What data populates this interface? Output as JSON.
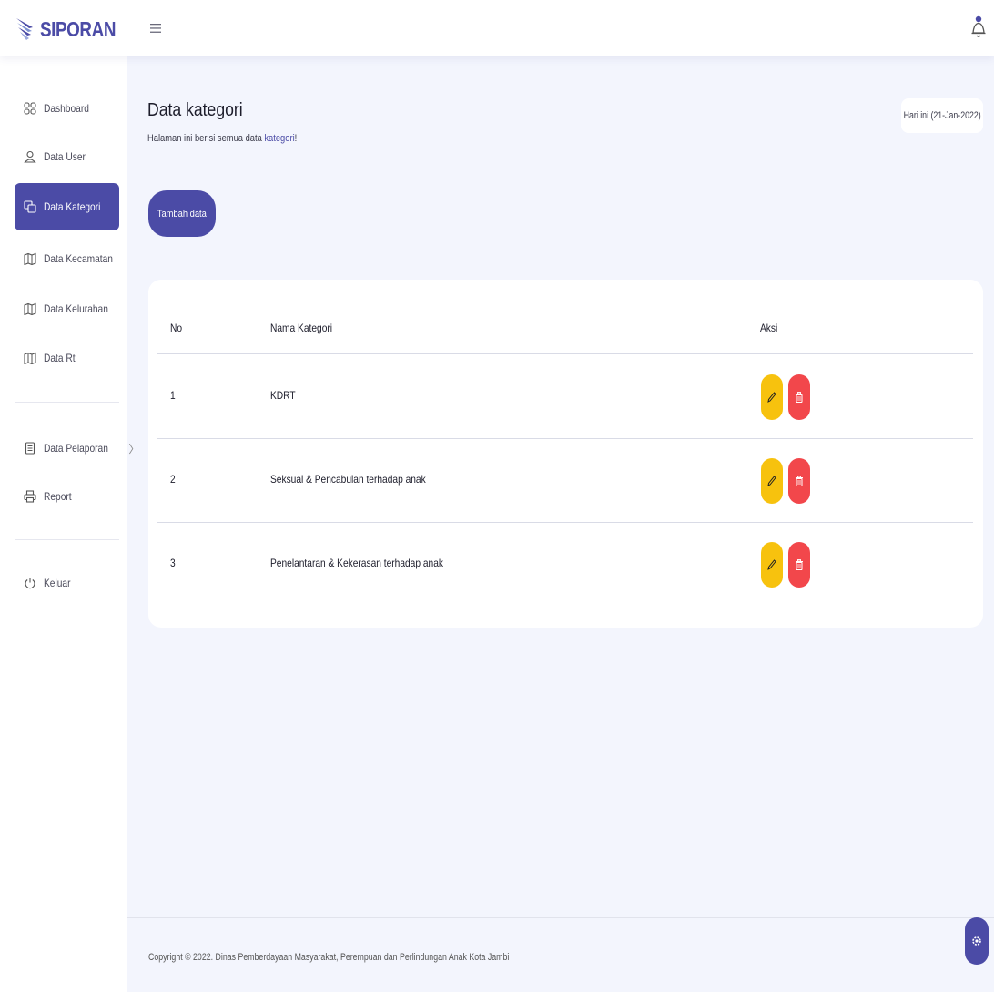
{
  "brand": {
    "name": "SIPORAN"
  },
  "colors": {
    "primary": "#4b4ba6",
    "edit": "#f7c20e",
    "delete": "#f2474b"
  },
  "icons": {
    "menu": "hamburger-icon",
    "notification": "bell-icon",
    "settings": "gear-icon"
  },
  "sidebar": {
    "items": [
      {
        "label": "Dashboard",
        "icon": "grid-icon"
      },
      {
        "label": "Data User",
        "icon": "user-icon"
      },
      {
        "label": "Data Kategori",
        "icon": "copy-icon",
        "active": true
      },
      {
        "label": "Data Kecamatan",
        "icon": "map-icon"
      },
      {
        "label": "Data Kelurahan",
        "icon": "map-icon"
      },
      {
        "label": "Data Rt",
        "icon": "map-icon"
      },
      {
        "label": "Data Pelaporan",
        "icon": "document-icon",
        "chevron": "〉"
      },
      {
        "label": "Report",
        "icon": "printer-icon"
      },
      {
        "label": "Keluar",
        "icon": "power-icon"
      }
    ]
  },
  "page": {
    "title": "Data kategori",
    "subtitle_prefix": "Halaman ini berisi semua data ",
    "subtitle_highlight": "kategori",
    "subtitle_suffix": "!",
    "date_badge": "Hari ini (21-Jan-2022)",
    "add_button": "Tambah data"
  },
  "table": {
    "headers": {
      "no": "No",
      "name": "Nama Kategori",
      "action": "Aksi"
    },
    "rows": [
      {
        "no": "1",
        "name": "KDRT"
      },
      {
        "no": "2",
        "name": "Seksual & Pencabulan terhadap anak"
      },
      {
        "no": "3",
        "name": "Penelantaran & Kekerasan terhadap anak"
      }
    ]
  },
  "footer": {
    "text": "Copyright © 2022. Dinas Pemberdayaan Masyarakat, Perempuan dan Perlindungan Anak Kota Jambi"
  }
}
